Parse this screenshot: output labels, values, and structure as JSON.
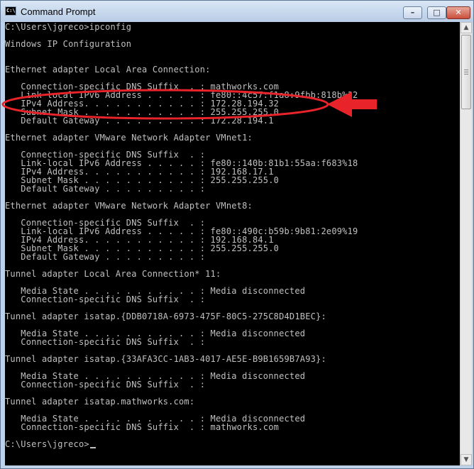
{
  "window": {
    "title": "Command Prompt",
    "icon_label": "C:\\"
  },
  "controls": {
    "minimize": "–",
    "maximize": "□",
    "close": "✕"
  },
  "console": {
    "lines": [
      "C:\\Users\\jgreco>ipconfig",
      "",
      "Windows IP Configuration",
      "",
      "",
      "Ethernet adapter Local Area Connection:",
      "",
      "   Connection-specific DNS Suffix  . : mathworks.com",
      "   Link-local IPv6 Address . . . . . : fe80::4c57:f1a8:9fbb:818b%12",
      "   IPv4 Address. . . . . . . . . . . : 172.28.194.32",
      "   Subnet Mask . . . . . . . . . . . : 255.255.255.0",
      "   Default Gateway . . . . . . . . . : 172.28.194.1",
      "",
      "Ethernet adapter VMware Network Adapter VMnet1:",
      "",
      "   Connection-specific DNS Suffix  . :",
      "   Link-local IPv6 Address . . . . . : fe80::140b:81b1:55aa:f683%18",
      "   IPv4 Address. . . . . . . . . . . : 192.168.17.1",
      "   Subnet Mask . . . . . . . . . . . : 255.255.255.0",
      "   Default Gateway . . . . . . . . . :",
      "",
      "Ethernet adapter VMware Network Adapter VMnet8:",
      "",
      "   Connection-specific DNS Suffix  . :",
      "   Link-local IPv6 Address . . . . . : fe80::490c:b59b:9b81:2e09%19",
      "   IPv4 Address. . . . . . . . . . . : 192.168.84.1",
      "   Subnet Mask . . . . . . . . . . . : 255.255.255.0",
      "   Default Gateway . . . . . . . . . :",
      "",
      "Tunnel adapter Local Area Connection* 11:",
      "",
      "   Media State . . . . . . . . . . . : Media disconnected",
      "   Connection-specific DNS Suffix  . :",
      "",
      "Tunnel adapter isatap.{DDB0718A-6973-475F-80C5-275C8D4D1BEC}:",
      "",
      "   Media State . . . . . . . . . . . : Media disconnected",
      "   Connection-specific DNS Suffix  . :",
      "",
      "Tunnel adapter isatap.{33AFA3CC-1AB3-4017-AE5E-B9B1659B7A93}:",
      "",
      "   Media State . . . . . . . . . . . : Media disconnected",
      "   Connection-specific DNS Suffix  . :",
      "",
      "Tunnel adapter isatap.mathworks.com:",
      "",
      "   Media State . . . . . . . . . . . : Media disconnected",
      "   Connection-specific DNS Suffix  . : mathworks.com",
      "",
      "C:\\Users\\jgreco>"
    ]
  },
  "colors": {
    "console_bg": "#000000",
    "console_text": "#c0c0c0",
    "annotation": "#e8232a"
  }
}
